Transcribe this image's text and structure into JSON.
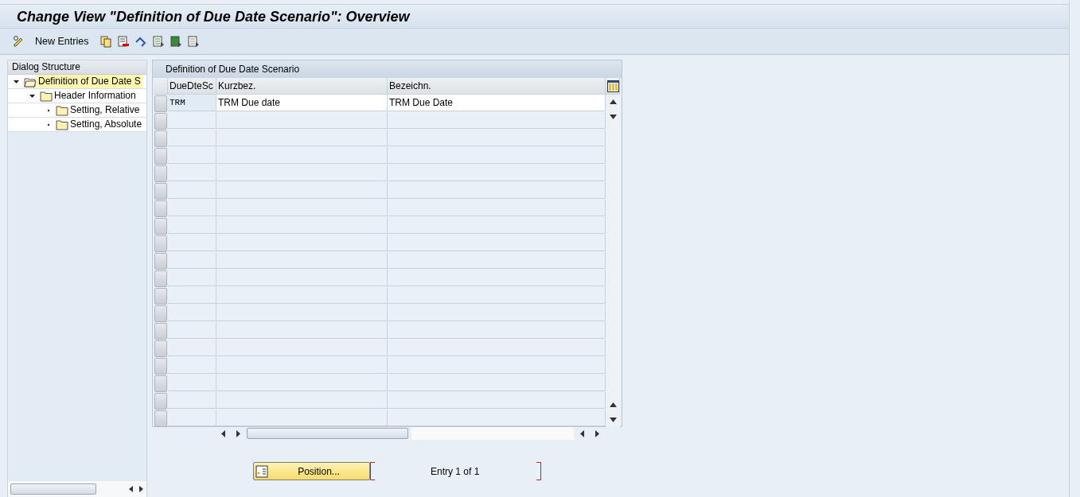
{
  "window": {
    "title": "Change View \"Definition of Due Date Scenario\": Overview"
  },
  "toolbar": {
    "new_entries_label": "New Entries"
  },
  "dialog_structure": {
    "title": "Dialog Structure",
    "tree": [
      {
        "label": "Definition of Due Date S",
        "selected": true,
        "expanded": true,
        "children": [
          {
            "label": "Header Information",
            "selected": false,
            "expanded": true,
            "children": [
              {
                "label": "Setting, Relative",
                "selected": false
              },
              {
                "label": "Setting, Absolute",
                "selected": false
              }
            ]
          }
        ]
      }
    ]
  },
  "table": {
    "title": "Definition of Due Date Scenario",
    "columns": [
      "DueDteSc",
      "Kurzbez.",
      "Bezeichn."
    ],
    "rows": [
      {
        "cells": [
          "TRM",
          "TRM Due date",
          "TRM Due Date"
        ]
      }
    ]
  },
  "footer": {
    "position_button": "Position...",
    "entry_info": "Entry 1 of 1"
  }
}
